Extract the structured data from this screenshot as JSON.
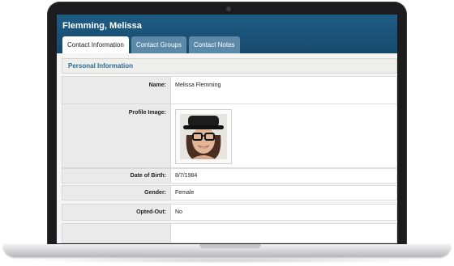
{
  "header": {
    "contact_name": "Flemming, Melissa"
  },
  "tabs": [
    {
      "label": "Contact Information",
      "active": true
    },
    {
      "label": "Contact Groups",
      "active": false
    },
    {
      "label": "Contact Notes",
      "active": false
    }
  ],
  "section": {
    "title": "Personal Information"
  },
  "fields": {
    "name": {
      "label": "Name:",
      "value": "Melissa Flemming"
    },
    "profile_image": {
      "label": "Profile Image:"
    },
    "dob": {
      "label": "Date of Birth:",
      "value": "8/7/1984"
    },
    "gender": {
      "label": "Gender:",
      "value": "Female"
    },
    "opted_out": {
      "label": "Opted-Out:",
      "value": "No"
    }
  },
  "colors": {
    "header": "#1e5c84",
    "accent": "#2a6c98"
  }
}
